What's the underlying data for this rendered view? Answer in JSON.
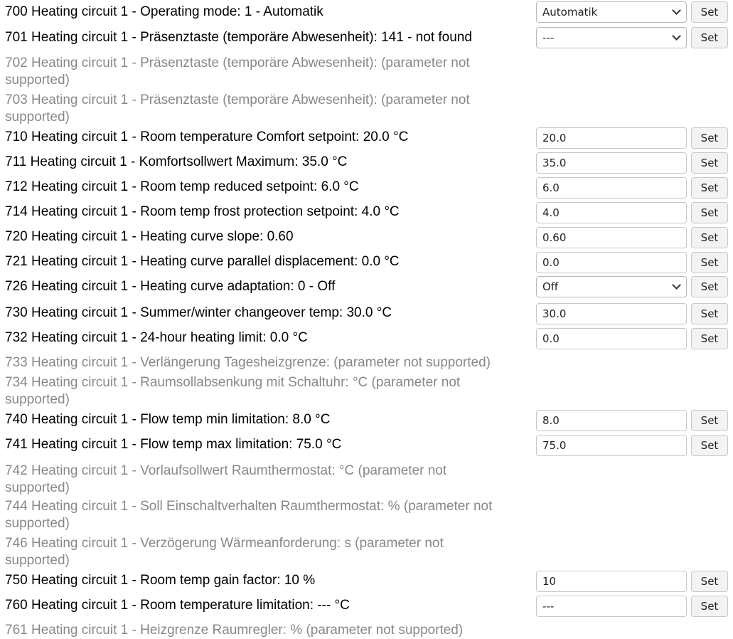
{
  "set_label": "Set",
  "params": [
    {
      "label": "700 Heating circuit 1 - Operating mode: 1 - Automatik",
      "control": "select",
      "value": "Automatik"
    },
    {
      "label": "701 Heating circuit 1 - Präsenztaste (temporäre Abwesenheit): 141 - not found",
      "control": "select",
      "value": "---"
    },
    {
      "label": "702 Heating circuit 1 - Präsenztaste (temporäre Abwesenheit): (parameter not supported)",
      "control": "none"
    },
    {
      "label": "703 Heating circuit 1 - Präsenztaste (temporäre Abwesenheit): (parameter not supported)",
      "control": "none"
    },
    {
      "label": "710 Heating circuit 1 - Room temperature Comfort setpoint: 20.0 °C",
      "control": "input",
      "value": "20.0"
    },
    {
      "label": "711 Heating circuit 1 - Komfortsollwert Maximum: 35.0 °C",
      "control": "input",
      "value": "35.0"
    },
    {
      "label": "712 Heating circuit 1 - Room temp reduced setpoint: 6.0 °C",
      "control": "input",
      "value": "6.0"
    },
    {
      "label": "714 Heating circuit 1 - Room temp frost protection setpoint: 4.0 °C",
      "control": "input",
      "value": "4.0"
    },
    {
      "label": "720 Heating circuit 1 - Heating curve slope: 0.60",
      "control": "input",
      "value": "0.60"
    },
    {
      "label": "721 Heating circuit 1 - Heating curve parallel displacement: 0.0 °C",
      "control": "input",
      "value": "0.0"
    },
    {
      "label": "726 Heating circuit 1 - Heating curve adaptation: 0 - Off",
      "control": "select",
      "value": "Off"
    },
    {
      "label": "730 Heating circuit 1 - Summer/winter changeover temp: 30.0 °C",
      "control": "input",
      "value": "30.0"
    },
    {
      "label": "732 Heating circuit 1 - 24-hour heating limit: 0.0 °C",
      "control": "input",
      "value": "0.0"
    },
    {
      "label": "733 Heating circuit 1 - Verlängerung Tagesheizgrenze: (parameter not supported)",
      "control": "none"
    },
    {
      "label": "734 Heating circuit 1 - Raumsollabsenkung mit Schaltuhr: °C (parameter not supported)",
      "control": "none"
    },
    {
      "label": "740 Heating circuit 1 - Flow temp min limitation: 8.0 °C",
      "control": "input",
      "value": "8.0"
    },
    {
      "label": "741 Heating circuit 1 - Flow temp max limitation: 75.0 °C",
      "control": "input",
      "value": "75.0"
    },
    {
      "label": "742 Heating circuit 1 - Vorlaufsollwert Raumthermostat: °C (parameter not supported)",
      "control": "none"
    },
    {
      "label": "744 Heating circuit 1 - Soll Einschaltverhalten Raumthermostat: % (parameter not supported)",
      "control": "none"
    },
    {
      "label": "746 Heating circuit 1 - Verzögerung Wärmeanforderung: s (parameter not supported)",
      "control": "none"
    },
    {
      "label": "750 Heating circuit 1 - Room temp gain factor: 10 %",
      "control": "input",
      "value": "10"
    },
    {
      "label": "760 Heating circuit 1 - Room temperature limitation: --- °C",
      "control": "input",
      "value": "---"
    },
    {
      "label": "761 Heating circuit 1 - Heizgrenze Raumregler: % (parameter not supported)",
      "control": "none"
    }
  ]
}
